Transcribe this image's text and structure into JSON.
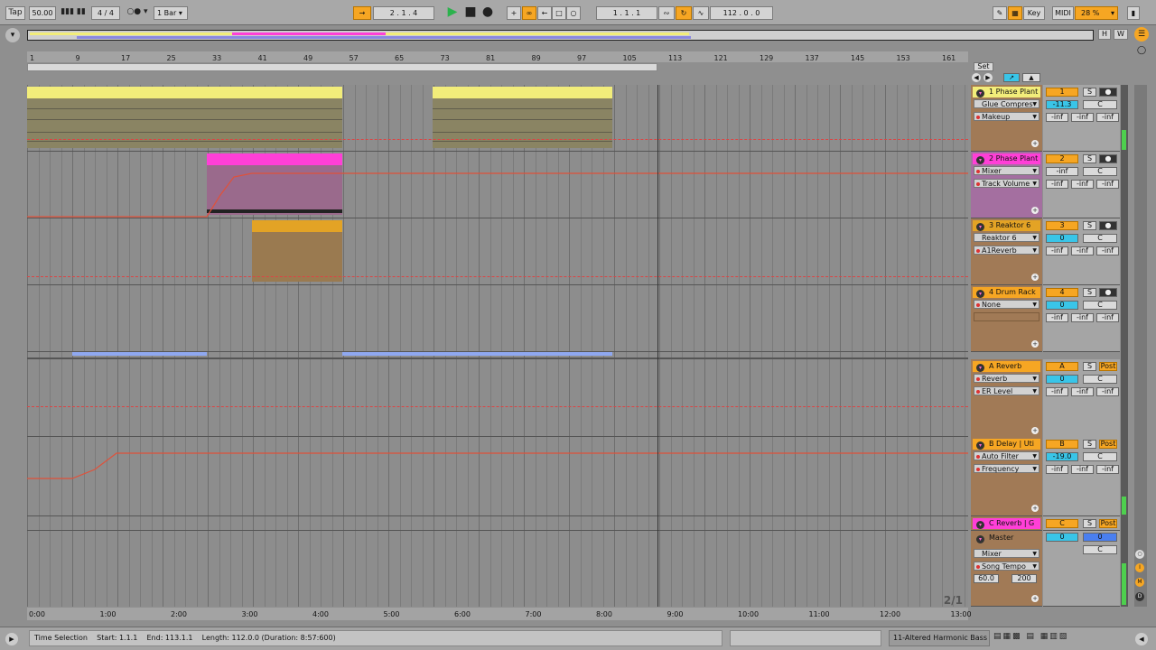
{
  "topbar": {
    "tap": "Tap",
    "tempo": "50.00",
    "signature": "4 / 4",
    "quantize": "1 Bar",
    "position": "2 .  1 .  4",
    "loop_start": "1 .  1 .  1",
    "loop_length": "112 .  0 .  0",
    "key": "Key",
    "midi": "MIDI",
    "cpu": "28 %",
    "accent": "#f6a623"
  },
  "overview": {
    "h": "H",
    "w": "W"
  },
  "ruler": {
    "bars": [
      "1",
      "9",
      "17",
      "25",
      "33",
      "41",
      "49",
      "57",
      "65",
      "73",
      "81",
      "89",
      "97",
      "105",
      "113",
      "121",
      "129",
      "137",
      "145",
      "153",
      "161"
    ],
    "times": [
      "0:00",
      "1:00",
      "2:00",
      "3:00",
      "4:00",
      "5:00",
      "6:00",
      "7:00",
      "8:00",
      "9:00",
      "10:00",
      "11:00",
      "12:00",
      "13:00"
    ]
  },
  "set_label": "Set",
  "tracks": [
    {
      "name": "1 Phase Plant",
      "color": "#f2ed7a",
      "device": "Glue Compres",
      "param": "Makeup",
      "num": "1",
      "vol": "-11.3",
      "pan": "C",
      "sends": [
        "-inf",
        "-inf",
        "-inf"
      ]
    },
    {
      "name": "2 Phase Plant",
      "color": "#ff3fd7",
      "device": "Mixer",
      "param": "Track Volume",
      "num": "2",
      "vol": "-inf",
      "pan": "C",
      "sends": [
        "-inf",
        "-inf",
        "-inf"
      ]
    },
    {
      "name": "3 Reaktor 6",
      "color": "#e3a325",
      "device": "Reaktor 6",
      "param": "A1Reverb",
      "num": "3",
      "vol": "0",
      "pan": "C",
      "sends": [
        "-inf",
        "-inf",
        "-inf"
      ]
    },
    {
      "name": "4 Drum Rack",
      "color": "#f6a623",
      "device": "None",
      "param": "",
      "num": "4",
      "vol": "0",
      "pan": "C",
      "sends": [
        "-inf",
        "-inf",
        "-inf"
      ]
    },
    {
      "name": "A Reverb",
      "color": "#f6a623",
      "device": "Reverb",
      "param": "ER Level",
      "num": "A",
      "vol": "0",
      "pan": "C",
      "sends": [
        "-inf",
        "-inf",
        "-inf"
      ],
      "post": "Post"
    },
    {
      "name": "B Delay | Uti",
      "color": "#f6a623",
      "device": "Auto Filter",
      "param": "Frequency",
      "num": "B",
      "vol": "-19.0",
      "pan": "C",
      "sends": [
        "-inf",
        "-inf",
        "-inf"
      ],
      "post": "Post"
    },
    {
      "name": "C Reverb | G",
      "color": "#ff3fd7",
      "num": "C",
      "post": "Post"
    },
    {
      "name": "Master",
      "device": "Mixer",
      "param": "Song Tempo",
      "min": "60.0",
      "max": "200",
      "vol": "0",
      "vol2": "0",
      "pan": "C"
    }
  ],
  "solo": "S",
  "page_indicator": "2/1",
  "status": {
    "mode": "Time Selection",
    "start": "Start: 1.1.1",
    "end": "End: 113.1.1",
    "length": "Length: 112.0.0  (Duration: 8:57:600)",
    "clip_name": "11-Altered Harmonic Bass"
  }
}
